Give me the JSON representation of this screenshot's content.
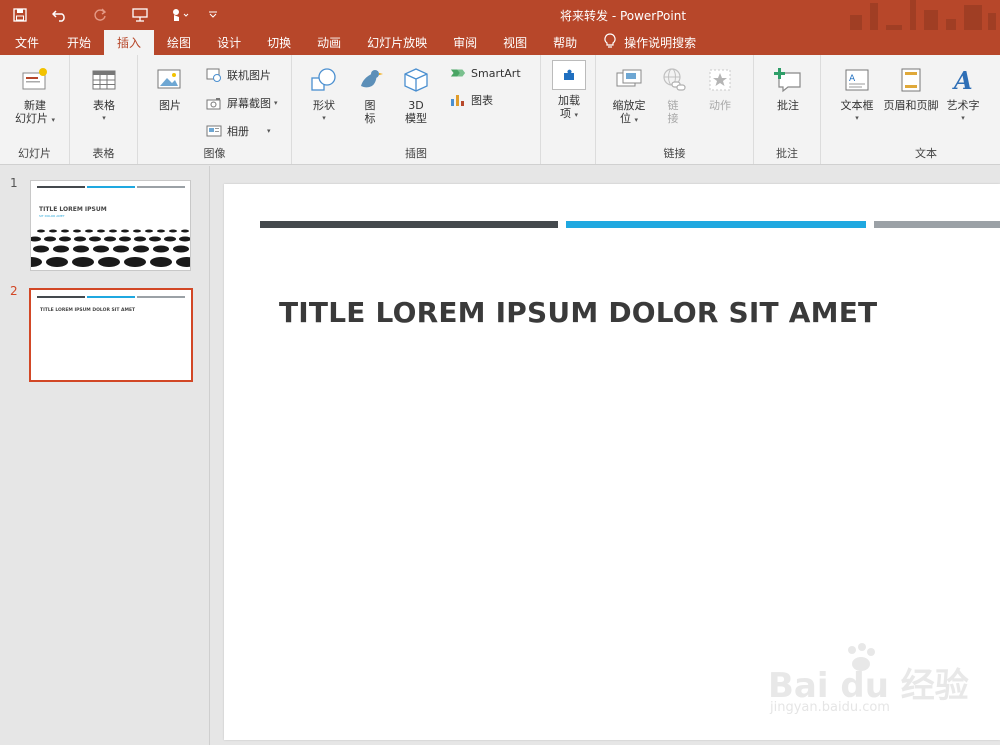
{
  "window": {
    "title": "将来转发  -  PowerPoint"
  },
  "tabs": [
    {
      "label": "文件"
    },
    {
      "label": "开始"
    },
    {
      "label": "插入"
    },
    {
      "label": "绘图"
    },
    {
      "label": "设计"
    },
    {
      "label": "切换"
    },
    {
      "label": "动画"
    },
    {
      "label": "幻灯片放映"
    },
    {
      "label": "审阅"
    },
    {
      "label": "视图"
    },
    {
      "label": "帮助"
    }
  ],
  "search": {
    "label": "操作说明搜索"
  },
  "ribbon": {
    "slides": {
      "group": "幻灯片",
      "new_slide_1": "新建",
      "new_slide_2": "幻灯片"
    },
    "tables": {
      "group": "表格",
      "table": "表格"
    },
    "images": {
      "group": "图像",
      "picture": "图片",
      "online_pictures": "联机图片",
      "screenshot": "屏幕截图",
      "album": "相册"
    },
    "illustrations": {
      "group": "插图",
      "shapes": "形状",
      "icons_1": "图",
      "icons_2": "标",
      "model_1": "3D",
      "model_2": "模型",
      "smartart": "SmartArt",
      "chart": "图表"
    },
    "addins": {
      "label_1": "加载",
      "label_2": "项"
    },
    "links": {
      "group": "链接",
      "zoom_1": "缩放定",
      "zoom_2": "位",
      "link_1": "链",
      "link_2": "接",
      "action": "动作"
    },
    "comments": {
      "group": "批注",
      "comment": "批注"
    },
    "text": {
      "group": "文本",
      "textbox": "文本框",
      "header_footer": "页眉和页脚",
      "wordart": "艺术字"
    }
  },
  "slides_panel": {
    "thumbs": [
      {
        "num": "1",
        "title": "TITLE LOREM IPSUM",
        "subtitle": "SIT DOLOR AMET"
      },
      {
        "num": "2",
        "title": "TITLE LOREM IPSUM DOLOR SIT AMET"
      }
    ]
  },
  "slide": {
    "title": "TITLE LOREM IPSUM DOLOR SIT AMET",
    "bar_colors": [
      "#44494d",
      "#1fa8e0",
      "#9ba1a6"
    ]
  },
  "watermark": {
    "logo": "Bai du 经验",
    "url": "jingyan.baidu.com"
  },
  "colors": {
    "accent": "#b7472a",
    "selection": "#d24726",
    "ribbon_bg": "#f3f3f3"
  }
}
